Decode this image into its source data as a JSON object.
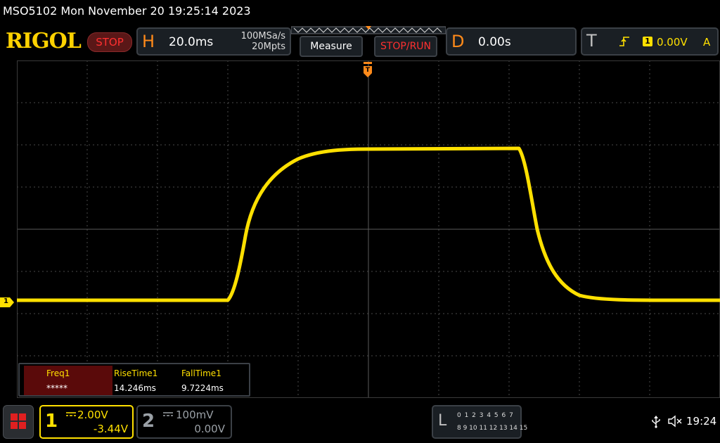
{
  "titlebar": {
    "text": "MSO5102  Mon November 20 19:25:14 2023"
  },
  "brand": {
    "logo": "RIGOL",
    "status": "STOP"
  },
  "horizontal": {
    "letter": "H",
    "timebase": "20.0ms",
    "sample_rate": "100MSa/s",
    "memory_depth": "20Mpts"
  },
  "buttons": {
    "measure": "Measure",
    "stop_run": "STOP/RUN"
  },
  "delay": {
    "letter": "D",
    "value": "0.00s"
  },
  "trigger": {
    "letter": "T",
    "edge_icon": "rising-edge-icon",
    "source": "1",
    "level": "0.00V",
    "mode": "A"
  },
  "channel_marker": {
    "ch1": "1"
  },
  "measurements": [
    {
      "name": "Freq1",
      "value": "*****"
    },
    {
      "name": "RiseTime1",
      "value": "14.246ms"
    },
    {
      "name": "FallTime1",
      "value": "9.7224ms"
    }
  ],
  "channels": [
    {
      "number": "1",
      "scale": "2.00V",
      "offset": "-3.44V",
      "active": true
    },
    {
      "number": "2",
      "scale": "100mV",
      "offset": "0.00V",
      "active": false
    }
  ],
  "logic_analyzer": {
    "letter": "L",
    "row1": "0 1 2 3  4 5 6 7",
    "row2": "8 9 10 11 12 13 14 15"
  },
  "status": {
    "usb_icon": "usb-icon",
    "speaker_icon": "speaker-muted-icon",
    "time": "19:24"
  },
  "colors": {
    "ch1": "#ffe000",
    "accent": "#ff8a1a",
    "stop": "#ff3030",
    "grid": "#4a4a4a"
  }
}
